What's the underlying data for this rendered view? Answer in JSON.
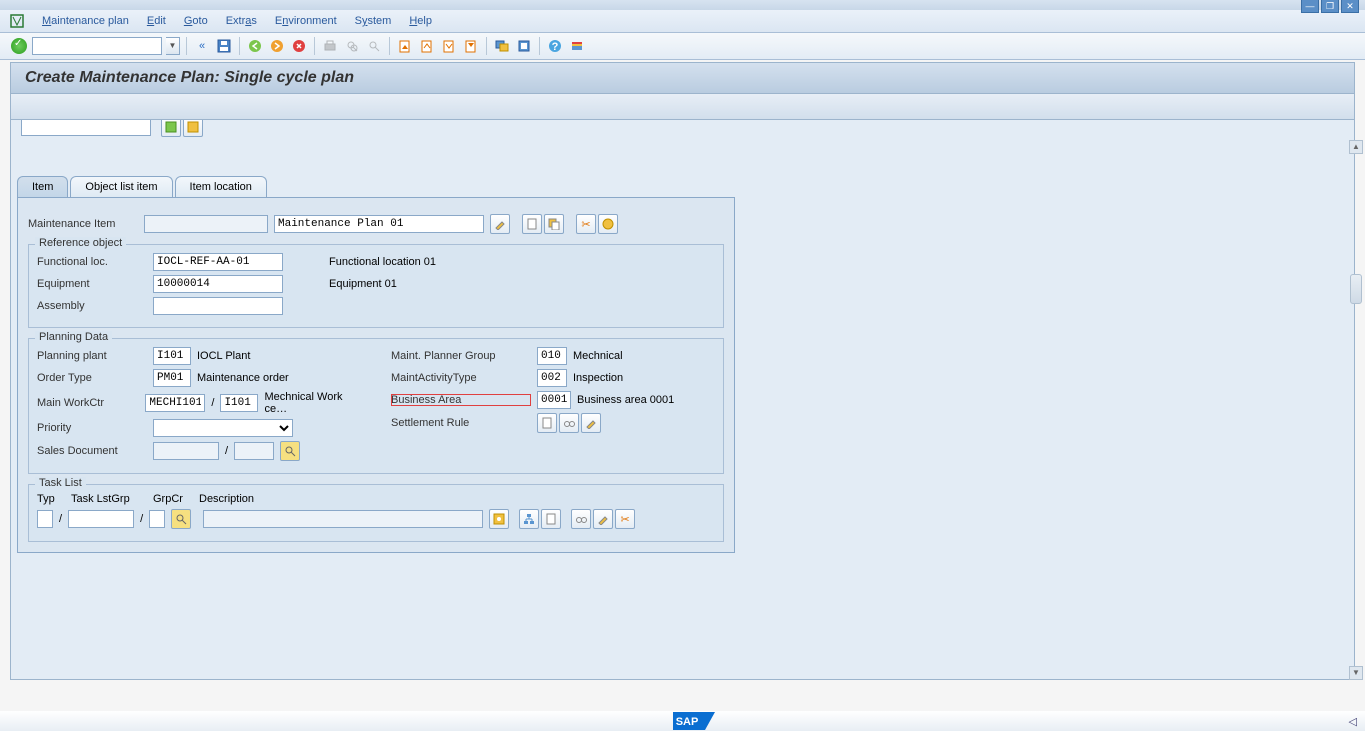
{
  "menu": {
    "items": [
      "Maintenance plan",
      "Edit",
      "Goto",
      "Extras",
      "Environment",
      "System",
      "Help"
    ]
  },
  "title": "Create Maintenance Plan: Single cycle plan",
  "tabs": {
    "item": "Item",
    "objectlist": "Object list item",
    "itemlocation": "Item location"
  },
  "maintItem": {
    "label": "Maintenance Item",
    "value": "",
    "desc": "Maintenance Plan 01"
  },
  "refObject": {
    "title": "Reference object",
    "funcLocLabel": "Functional loc.",
    "funcLoc": "IOCL-REF-AA-01",
    "funcLocDesc": "Functional location 01",
    "equipLabel": "Equipment",
    "equip": "10000014",
    "equipDesc": "Equipment 01",
    "assemblyLabel": "Assembly",
    "assembly": ""
  },
  "planning": {
    "title": "Planning Data",
    "plantLabel": "Planning plant",
    "plant": "I101",
    "plantDesc": "IOCL Plant",
    "orderTypeLabel": "Order Type",
    "orderType": "PM01",
    "orderTypeDesc": "Maintenance order",
    "workCtrLabel": "Main WorkCtr",
    "workCtr": "MECHI101",
    "workCtr2": "I101",
    "workCtrDesc": "Mechnical Work ce…",
    "priorityLabel": "Priority",
    "priority": "",
    "salesDocLabel": "Sales Document",
    "salesDoc1": "",
    "salesDoc2": "",
    "plannerGroupLabel": "Maint. Planner Group",
    "plannerGroup": "010",
    "plannerGroupDesc": "Mechnical",
    "actTypeLabel": "MaintActivityType",
    "actType": "002",
    "actTypeDesc": "Inspection",
    "busAreaLabel": "Business Area",
    "busArea": "0001",
    "busAreaDesc": "Business area 0001",
    "settleRuleLabel": "Settlement Rule"
  },
  "taskList": {
    "title": "Task List",
    "typLabel": "Typ",
    "lstGrpLabel": "Task LstGrp",
    "grpCrLabel": "GrpCr",
    "descLabel": "Description",
    "typ": "",
    "lstGrp": "",
    "grpCr": "",
    "desc": ""
  },
  "footer": {
    "sap": "SAP"
  }
}
